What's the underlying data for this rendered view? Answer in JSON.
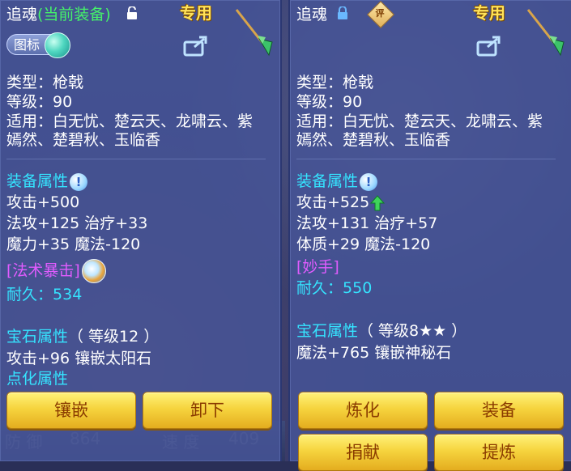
{
  "background": {
    "left_strip": [
      "防 御",
      "864",
      "速 度",
      "409"
    ]
  },
  "left": {
    "name": "追魂",
    "status": "(当前装备)",
    "exclusive": "专用",
    "icon_label": "图标",
    "type": "类型：枪戟",
    "level": "等级：90",
    "suits_line1": "适用：白无忧、楚云天、龙啸云、紫",
    "suits_line2": "嫣然、楚碧秋、玉临香",
    "equip_attr_title": "装备属性",
    "attack": "攻击+500",
    "magic_attack_heal": "法攻+125 治疗+33",
    "mana": "魔力+35 魔法-120",
    "special": "[法术暴击]",
    "durability_label": "耐久：",
    "durability_value": "534",
    "gem_title": "宝石属性",
    "gem_level": "（ 等级12 ）",
    "gem_effect": "攻击+96 镶嵌太阳石",
    "dianhua": "点化属性",
    "buttons": [
      "镶嵌",
      "卸下"
    ]
  },
  "right": {
    "name": "追魂",
    "rating_icon_text": "评",
    "exclusive": "专用",
    "type": "类型：枪戟",
    "level": "等级：90",
    "suits_line1": "适用：白无忧、楚云天、龙啸云、紫",
    "suits_line2": "嫣然、楚碧秋、玉临香",
    "equip_attr_title": "装备属性",
    "attack": "攻击+525",
    "magic_attack_heal": "法攻+131 治疗+57",
    "constitution": "体质+29 魔法-120",
    "special": "[妙手]",
    "durability_label": "耐久：",
    "durability_value": "550",
    "gem_title": "宝石属性",
    "gem_level": "（ 等级8★★ ）",
    "gem_effect": "魔法+765 镶嵌神秘石",
    "buttons": [
      "炼化",
      "装备",
      "捐献",
      "提炼"
    ]
  },
  "colors": {
    "cyan": "#35e4ff",
    "green": "#45f26a",
    "purple": "#e15cff",
    "gold_button": "#f6d43e"
  }
}
